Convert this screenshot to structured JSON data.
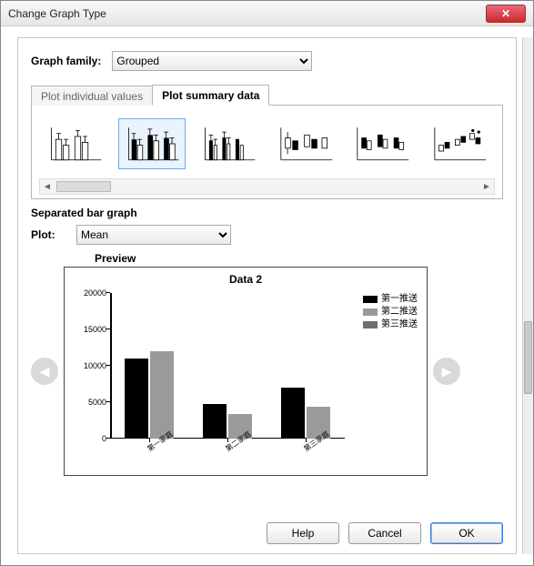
{
  "window": {
    "title": "Change Graph Type"
  },
  "family": {
    "label": "Graph family:",
    "selected": "Grouped"
  },
  "tabs": {
    "individual": "Plot individual values",
    "summary": "Plot summary data",
    "active": "summary"
  },
  "subtitle": "Separated bar graph",
  "plot": {
    "label": "Plot:",
    "selected": "Mean"
  },
  "preview_label": "Preview",
  "buttons": {
    "help": "Help",
    "cancel": "Cancel",
    "ok": "OK"
  },
  "chart_data": {
    "type": "bar",
    "title": "Data 2",
    "xlabel": "",
    "ylabel": "",
    "ylim": [
      0,
      20000
    ],
    "yticks": [
      0,
      5000,
      10000,
      15000,
      20000
    ],
    "categories": [
      "第一家庭",
      "第二家庭",
      "第三家庭"
    ],
    "series": [
      {
        "name": "第一推送",
        "color": "#000000",
        "values": [
          11000,
          4700,
          7000
        ]
      },
      {
        "name": "第二推送",
        "color": "#9a9a9a",
        "values": [
          12000,
          3400,
          4400
        ]
      },
      {
        "name": "第三推送",
        "color": "#6f6f6f",
        "values": [
          null,
          null,
          null
        ]
      }
    ]
  }
}
